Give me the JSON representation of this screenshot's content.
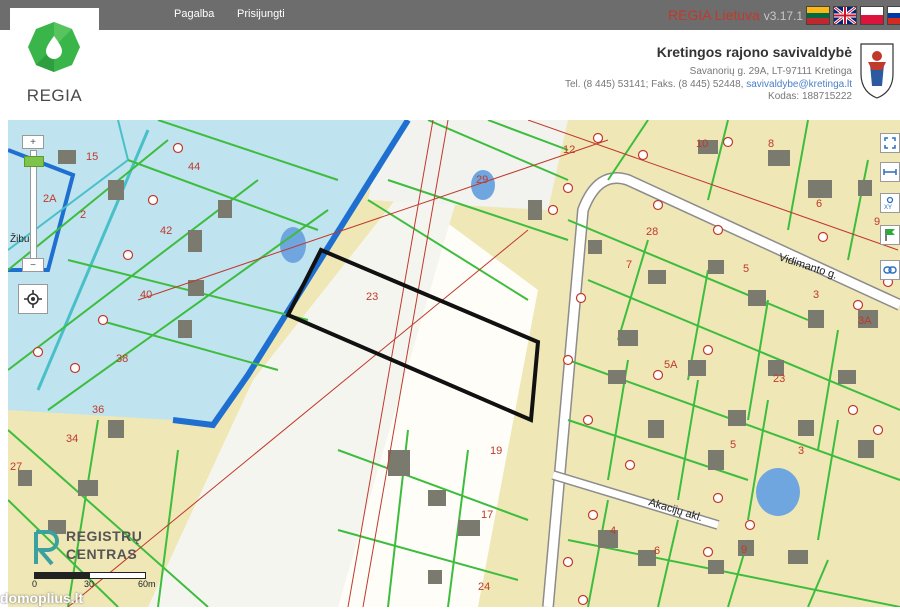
{
  "nav": {
    "help_label": "Pagalba",
    "login_label": "Prisijungti"
  },
  "brand": {
    "name": "REGIA Lietuva",
    "version": "v3.17.1"
  },
  "languages": [
    "lt-flag-icon",
    "en-flag-icon",
    "pl-flag-icon",
    "ru-flag-icon"
  ],
  "logo": {
    "text": "REGIA",
    "color": "#39b54a"
  },
  "municipality": {
    "name": "Kretingos rajono savivaldybė",
    "address": "Savanorių g. 29A, LT-97111 Kretinga",
    "contacts_prefix": "Tel. (8 445) 53141; Faks. (8 445) 52448,",
    "email": "savivaldybe@kretinga.lt",
    "code": "Kodas: 188715222"
  },
  "map": {
    "street_labels": [
      "Vidimanto g.",
      "Akacijų akl.",
      "Žibuo"
    ],
    "parcel_numbers": [
      "15",
      "2A",
      "2",
      "44",
      "42",
      "40",
      "38",
      "36",
      "34",
      "27",
      "29",
      "12",
      "10",
      "8",
      "6",
      "9",
      "28",
      "7",
      "5",
      "3",
      "3A",
      "5A",
      "23",
      "19",
      "17",
      "24",
      "4",
      "6",
      "9",
      "5",
      "3"
    ],
    "selected_parcel_label": "23",
    "controls": {
      "zoom_in": "+",
      "zoom_out": "−",
      "locate": "locate-icon"
    },
    "right_tools": [
      "expand-icon",
      "measure-icon",
      "xy-icon",
      "flag-icon",
      "link-icon"
    ],
    "scale": {
      "labels": [
        "0",
        "30",
        "60m"
      ]
    },
    "provider": {
      "line1": "REGISTRŲ",
      "line2": "CENTRAS"
    },
    "watermark_text": "domoplius.lt",
    "colors": {
      "ground": "#efe7b5",
      "parcel_border": "#3dbd3d",
      "protected_zone": "#bfe3ef",
      "zone_border": "#1f6fd1",
      "road": "#ffffff",
      "cadastral_line": "#c0392b",
      "selection": "#111111"
    }
  }
}
